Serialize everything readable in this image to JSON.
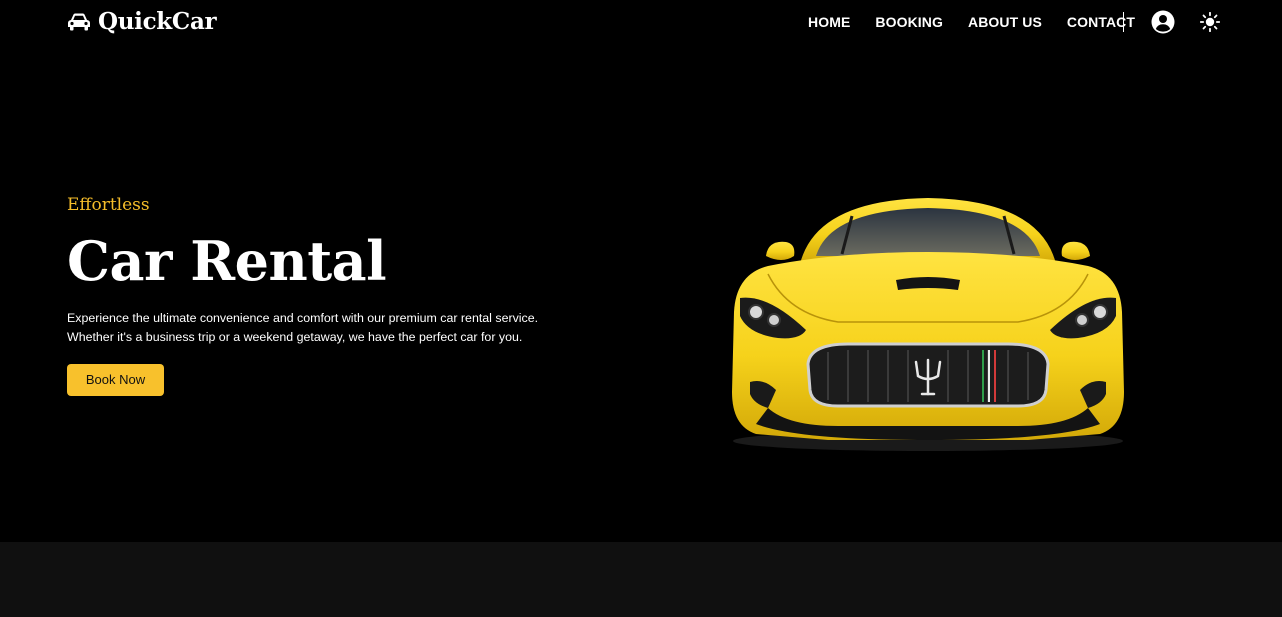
{
  "brand": {
    "name": "QuickCar",
    "logo_icon": "car-icon"
  },
  "nav": {
    "items": [
      {
        "label": "HOME"
      },
      {
        "label": "BOOKING"
      },
      {
        "label": "ABOUT US"
      },
      {
        "label": "CONTACT"
      }
    ],
    "user_icon": "user-circle-icon",
    "theme_icon": "sun-icon"
  },
  "hero": {
    "eyebrow": "Effortless",
    "title": "Car Rental",
    "description": "Experience the ultimate convenience and comfort with our premium car rental service. Whether it's a business trip or a weekend getaway, we have the perfect car for you.",
    "cta_label": "Book Now",
    "image_icon": "yellow-sports-car"
  },
  "colors": {
    "background": "#000000",
    "accent": "#f8c12c",
    "eyebrow": "#f5bd2a",
    "section_bg": "#101010",
    "car_body": "#f6d21b"
  }
}
